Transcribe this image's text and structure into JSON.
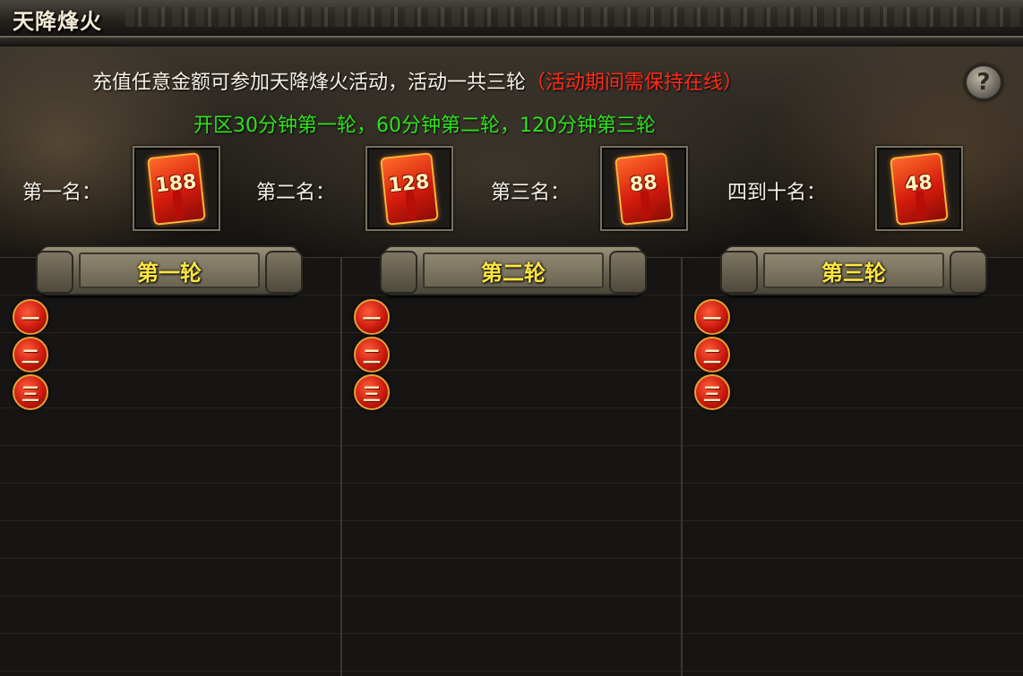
{
  "window": {
    "title": "天降烽火"
  },
  "info": {
    "line1_main": "充值任意金额可参加天降烽火活动，活动一共三轮",
    "line1_note": "（活动期间需保持在线）",
    "line2": "开区30分钟第一轮，60分钟第二轮，120分钟第三轮",
    "help_symbol": "?"
  },
  "rewards": [
    {
      "label": "第一名：",
      "amount": "188"
    },
    {
      "label": "第二名：",
      "amount": "128"
    },
    {
      "label": "第三名：",
      "amount": "88"
    },
    {
      "label": "四到十名：",
      "amount": "48"
    }
  ],
  "rounds": [
    {
      "label": "第一轮",
      "ranks": [
        "一",
        "二",
        "三"
      ]
    },
    {
      "label": "第二轮",
      "ranks": [
        "一",
        "二",
        "三"
      ]
    },
    {
      "label": "第三轮",
      "ranks": [
        "一",
        "二",
        "三"
      ]
    }
  ],
  "colors": {
    "highlight_red": "#ff2a1a",
    "highlight_green": "#2fe21b",
    "round_label": "#ffe640"
  }
}
